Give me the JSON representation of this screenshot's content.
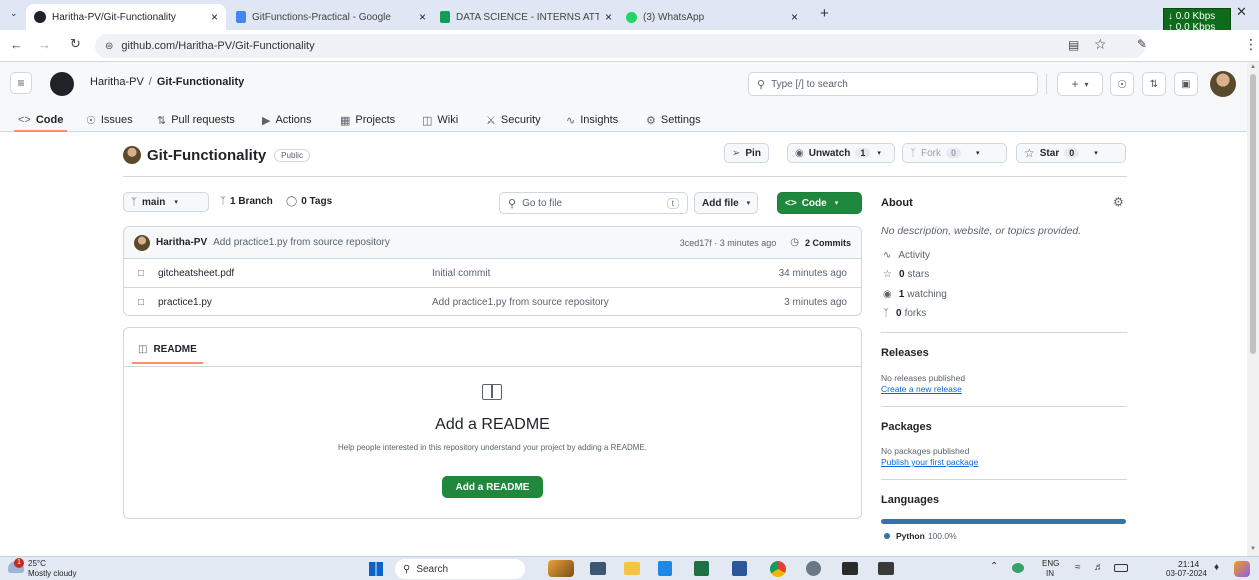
{
  "browser": {
    "tabs": [
      {
        "label": "Haritha-PV/Git-Functionality"
      },
      {
        "label": "GitFunctions-Practical - Google"
      },
      {
        "label": "DATA SCIENCE - INTERNS ATTE"
      },
      {
        "label": "(3) WhatsApp"
      }
    ],
    "url": "github.com/Haritha-PV/Git-Functionality",
    "net_down": "↓ 0.0 Kbps",
    "net_up": "↑ 0.0 Kbps"
  },
  "header": {
    "owner": "Haritha-PV",
    "separator": "/",
    "repo": "Git-Functionality",
    "search_placeholder": "Type [/] to search",
    "plus": "+"
  },
  "nav": {
    "code": "Code",
    "issues": "Issues",
    "pull_requests": "Pull requests",
    "actions": "Actions",
    "projects": "Projects",
    "wiki": "Wiki",
    "security": "Security",
    "insights": "Insights",
    "settings": "Settings"
  },
  "repo": {
    "name": "Git-Functionality",
    "visibility": "Public",
    "pin": "Pin",
    "unwatch": "Unwatch",
    "watch_count": "1",
    "fork": "Fork",
    "fork_count": "0",
    "star": "Star",
    "star_count": "0"
  },
  "toolbar": {
    "branch": "main",
    "branches": "1 Branch",
    "tags": "0 Tags",
    "go_to_file": "Go to file",
    "shortcut": "t",
    "add_file": "Add file",
    "code": "Code"
  },
  "commit": {
    "author": "Haritha-PV",
    "message": "Add practice1.py from source repository",
    "hash_time": "3ced17f · 3 minutes ago",
    "commits": "2 Commits"
  },
  "files": [
    {
      "name": "gitcheatsheet.pdf",
      "message": "Initial commit",
      "time": "34 minutes ago"
    },
    {
      "name": "practice1.py",
      "message": "Add practice1.py from source repository",
      "time": "3 minutes ago"
    }
  ],
  "readme": {
    "tab": "README",
    "title": "Add a README",
    "desc": "Help people interested in this repository understand your project by adding a README.",
    "button": "Add a README"
  },
  "about": {
    "title": "About",
    "desc": "No description, website, or topics provided.",
    "activity": "Activity",
    "stars": "0",
    "stars_label": "stars",
    "watching": "1",
    "watching_label": "watching",
    "forks": "0",
    "forks_label": "forks"
  },
  "releases": {
    "title": "Releases",
    "none": "No releases published",
    "link": "Create a new release"
  },
  "packages": {
    "title": "Packages",
    "none": "No packages published",
    "link": "Publish your first package"
  },
  "languages": {
    "title": "Languages",
    "items": [
      {
        "name": "Python",
        "percent": "100.0%",
        "fraction": 1.0,
        "color": "#3572A5"
      }
    ]
  },
  "taskbar": {
    "temp": "25°C",
    "weather": "Mostly cloudy",
    "badge": "1",
    "search": "Search",
    "lang1": "ENG",
    "lang2": "IN",
    "time": "21:14",
    "date": "03-07-2024"
  },
  "colors": {
    "accent": "#0969da",
    "primary_button": "#1f883d",
    "underline": "#fd8c73"
  }
}
